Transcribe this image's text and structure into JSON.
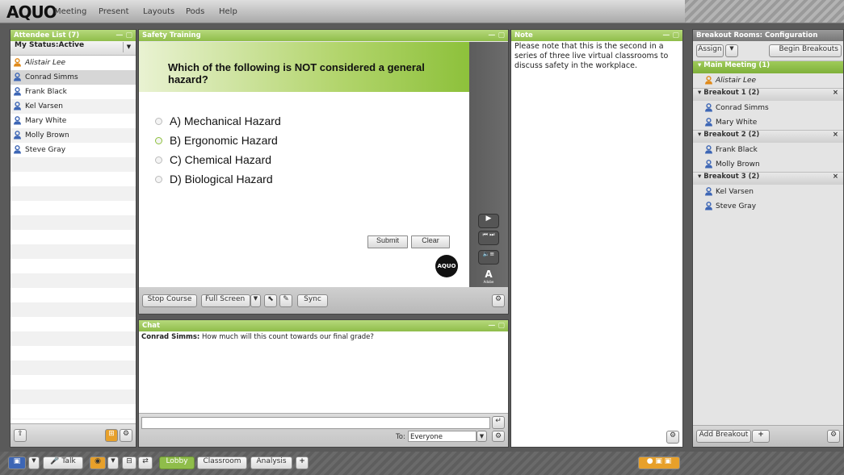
{
  "app": {
    "logo": "AQUO"
  },
  "menu": [
    "Meeting",
    "Present",
    "Layouts",
    "Pods",
    "Help"
  ],
  "attendee": {
    "title": "Attendee List (7)",
    "status": "My Status:Active",
    "items": [
      {
        "name": "Alistair Lee",
        "host": true
      },
      {
        "name": "Conrad Simms",
        "host": false
      },
      {
        "name": "Frank Black",
        "host": false
      },
      {
        "name": "Kel Varsen",
        "host": false
      },
      {
        "name": "Mary White",
        "host": false
      },
      {
        "name": "Molly Brown",
        "host": false
      },
      {
        "name": "Steve Gray",
        "host": false
      }
    ]
  },
  "training": {
    "title": "Safety Training",
    "question": "Which of the following is NOT considered a general hazard?",
    "options": [
      "A) Mechanical Hazard",
      "B) Ergonomic Hazard",
      "C) Chemical Hazard",
      "D) Biological Hazard"
    ],
    "submit": "Submit",
    "clear": "Clear",
    "badge": "AQUO",
    "adobe": "Adobe",
    "stop": "Stop Course",
    "fullscreen": "Full Screen",
    "sync": "Sync"
  },
  "note": {
    "title": "Note",
    "text": "Please note that this is the second in a series of three live virtual classrooms to discuss safety in the workplace."
  },
  "chat": {
    "title": "Chat",
    "sender": "Conrad Simms:",
    "message": "How much will this count towards our final grade?",
    "to_label": "To:",
    "to_value": "Everyone"
  },
  "breakout": {
    "title": "Breakout Rooms: Configuration",
    "assign": "Assign",
    "begin": "Begin Breakouts",
    "groups": [
      {
        "label": "Main Meeting (1)",
        "main": true,
        "members": [
          "Alistair Lee"
        ]
      },
      {
        "label": "Breakout 1 (2)",
        "main": false,
        "members": [
          "Conrad Simms",
          "Mary White"
        ]
      },
      {
        "label": "Breakout 2 (2)",
        "main": false,
        "members": [
          "Frank Black",
          "Molly Brown"
        ]
      },
      {
        "label": "Breakout 3 (2)",
        "main": false,
        "members": [
          "Kel Varsen",
          "Steve Gray"
        ]
      }
    ],
    "add": "Add Breakout"
  },
  "bottom": {
    "talk": "Talk",
    "tabs": [
      "Lobby",
      "Classroom",
      "Analysis"
    ],
    "add": "+"
  },
  "icons": [
    "user-icon",
    "host-user-icon",
    "gear-icon",
    "play-icon",
    "prev-icon",
    "next-icon",
    "volume-icon",
    "camera-icon",
    "microphone-icon",
    "send-icon",
    "dropdown-icon",
    "pointer-icon",
    "edit-icon"
  ],
  "colors": {
    "accent_green": "#8fbd4a",
    "user_blue": "#3d66b5",
    "host_orange": "#e08a1a"
  }
}
